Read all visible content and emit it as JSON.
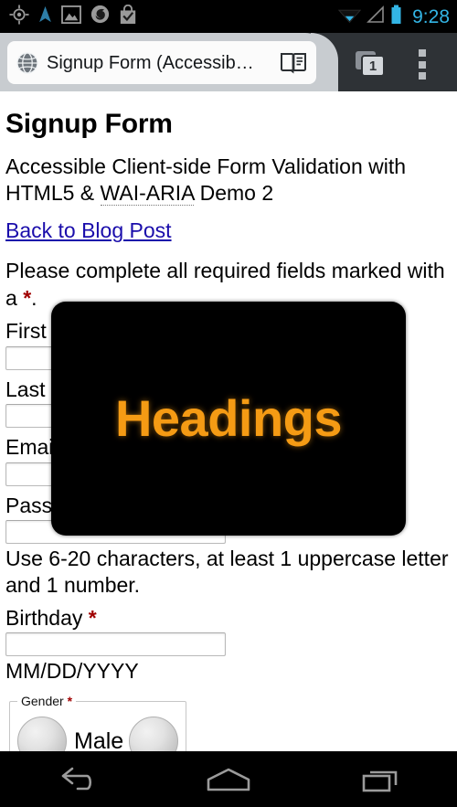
{
  "status_bar": {
    "time": "9:28",
    "accent_color": "#33b5e5",
    "left_icons": [
      {
        "name": "gps-location-icon"
      },
      {
        "name": "navigation-arrow-icon"
      },
      {
        "name": "photo-image-icon"
      },
      {
        "name": "firefox-icon"
      },
      {
        "name": "shopping-bag-check-icon"
      }
    ],
    "right_icons": [
      {
        "name": "wifi-icon"
      },
      {
        "name": "cell-signal-icon"
      },
      {
        "name": "battery-icon"
      }
    ]
  },
  "browser": {
    "tab_title": "Signup Form (Accessib…",
    "favicon_name": "globe-icon",
    "reader_mode_name": "reader-mode-icon",
    "tab_count": "1",
    "menu_name": "overflow-menu-icon"
  },
  "page": {
    "title": "Signup Form",
    "lede_part1": "Accessible Client-side Form Validation with HTML5 & ",
    "lede_abbr": "WAI-ARIA",
    "lede_part2": " Demo 2",
    "back_link": "Back to Blog Post",
    "instructions_text": "Please complete all required fields marked with a ",
    "instructions_marker": "*",
    "instructions_tail": ".",
    "fields": [
      {
        "label": "First ",
        "value": "",
        "name": "first-name"
      },
      {
        "label": "Last N",
        "value": "",
        "name": "last-name"
      },
      {
        "label": "Emai",
        "value": "",
        "name": "email"
      },
      {
        "label": "Passw",
        "value": "",
        "name": "password"
      }
    ],
    "password_helper": "Use 6-20 characters, at least 1 uppercase letter and 1 number.",
    "birthday_label": "Birthday ",
    "birthday_marker": "*",
    "birthday_value": "",
    "birthday_format": "MM/DD/YYYY",
    "gender_legend": "Gender ",
    "gender_marker": "*",
    "gender_options": [
      {
        "label": "Male",
        "name": "gender-male"
      },
      {
        "label": "",
        "name": "gender-female"
      }
    ]
  },
  "overlay": {
    "text": "Headings",
    "text_color": "#f59b14",
    "background_color": "#000000"
  },
  "nav_bar": {
    "buttons": [
      {
        "name": "back-button"
      },
      {
        "name": "home-button"
      },
      {
        "name": "recents-button"
      }
    ]
  }
}
